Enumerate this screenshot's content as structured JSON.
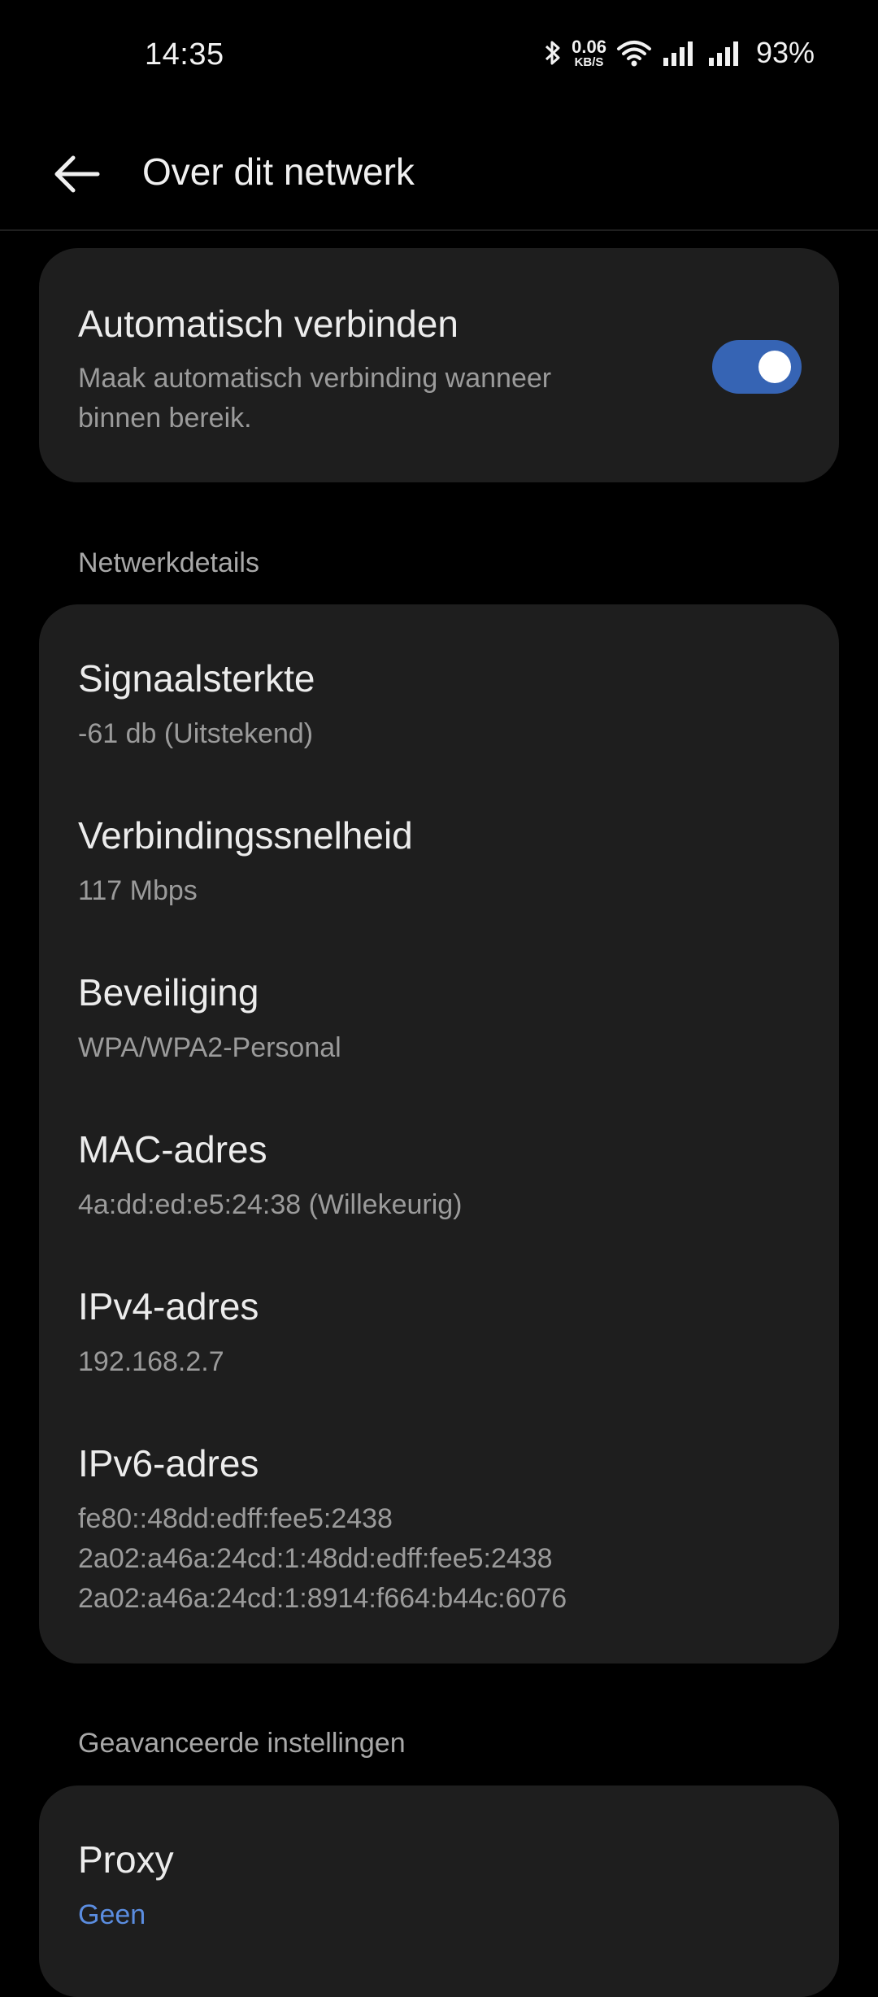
{
  "status_bar": {
    "time": "14:35",
    "net_speed_value": "0.06",
    "net_speed_unit": "KB/S",
    "battery": "93%",
    "icons": [
      "bluetooth-icon",
      "wifi-icon",
      "signal-icon",
      "signal-icon"
    ]
  },
  "header": {
    "title": "Over dit netwerk"
  },
  "auto_connect": {
    "title": "Automatisch verbinden",
    "subtitle_line1": "Maak automatisch verbinding wanneer",
    "subtitle_line2": "binnen bereik.",
    "enabled": true
  },
  "network_details": {
    "section_label": "Netwerkdetails",
    "items": [
      {
        "label": "Signaalsterkte",
        "value": "-61 db (Uitstekend)"
      },
      {
        "label": "Verbindingssnelheid",
        "value": "117 Mbps"
      },
      {
        "label": "Beveiliging",
        "value": "WPA/WPA2-Personal"
      },
      {
        "label": "MAC-adres",
        "value": "4a:dd:ed:e5:24:38 (Willekeurig)"
      },
      {
        "label": "IPv4-adres",
        "value": "192.168.2.7"
      },
      {
        "label": "IPv6-adres",
        "values": [
          "fe80::48dd:edff:fee5:2438",
          "2a02:a46a:24cd:1:48dd:edff:fee5:2438",
          "2a02:a46a:24cd:1:8914:f664:b44c:6076"
        ]
      }
    ]
  },
  "advanced": {
    "section_label": "Geavanceerde instellingen",
    "proxy": {
      "label": "Proxy",
      "value": "Geen"
    }
  },
  "colors": {
    "accent": "#3664b4",
    "link": "#5b8de0",
    "card": "#1e1e1e",
    "background": "#000000"
  }
}
